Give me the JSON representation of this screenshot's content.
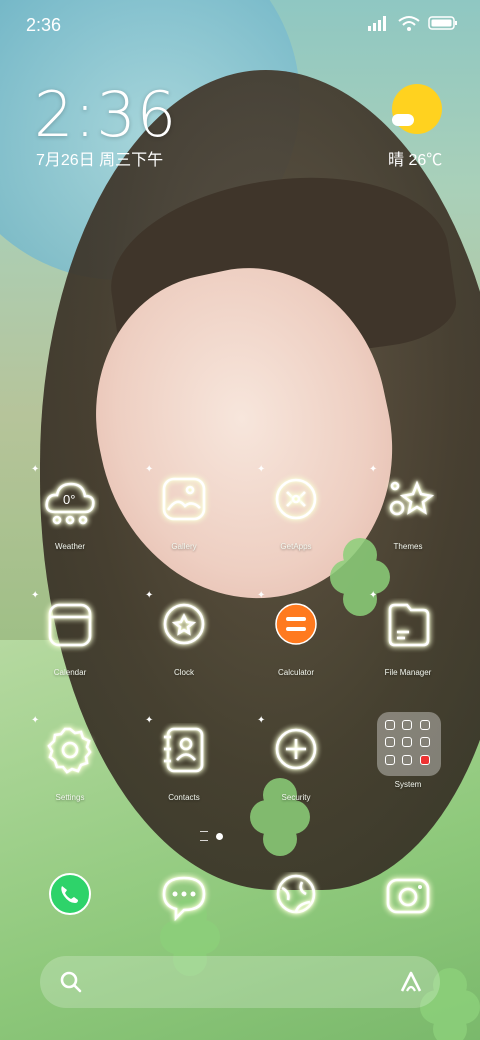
{
  "status_bar": {
    "time": "2:36"
  },
  "clock_widget": {
    "time": "2:36",
    "date": "7月26日 周三下午"
  },
  "weather_widget": {
    "text": "晴 26℃",
    "icon": "sunny-cloud-icon"
  },
  "apps": [
    {
      "label": "Weather",
      "icon": "weather-cloud-icon",
      "badge": "0°"
    },
    {
      "label": "Gallery",
      "icon": "gallery-icon"
    },
    {
      "label": "GetApps",
      "icon": "getapps-icon"
    },
    {
      "label": "Themes",
      "icon": "themes-icon"
    },
    {
      "label": "Calendar",
      "icon": "calendar-icon"
    },
    {
      "label": "Clock",
      "icon": "clock-icon"
    },
    {
      "label": "Calculator",
      "icon": "calculator-icon"
    },
    {
      "label": "File Manager",
      "icon": "file-manager-icon"
    },
    {
      "label": "Settings",
      "icon": "settings-gear-icon"
    },
    {
      "label": "Contacts",
      "icon": "contacts-book-icon"
    },
    {
      "label": "Security",
      "icon": "security-plus-icon"
    },
    {
      "label": "System",
      "icon": "system-folder-icon"
    }
  ],
  "dock": [
    {
      "icon": "phone-icon"
    },
    {
      "icon": "messages-icon"
    },
    {
      "icon": "browser-icon"
    },
    {
      "icon": "camera-icon"
    }
  ],
  "search_bar": {
    "left_icon": "search-icon",
    "right_icon": "assistant-icon"
  },
  "colors": {
    "accent_orange": "#ff7a1f",
    "phone_green": "#2ed36a",
    "sun_yellow": "#ffd21f"
  }
}
